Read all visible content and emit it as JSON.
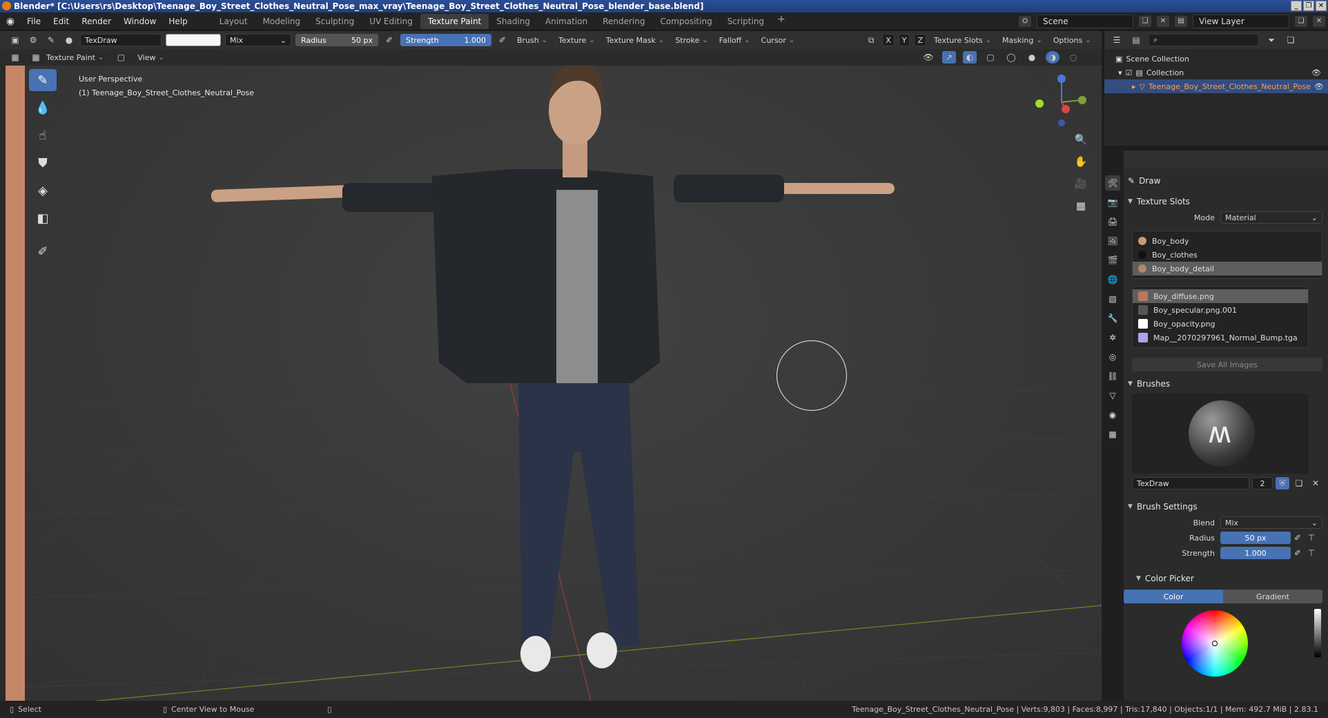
{
  "window": {
    "title": "Blender* [C:\\Users\\rs\\Desktop\\Teenage_Boy_Street_Clothes_Neutral_Pose_max_vray\\Teenage_Boy_Street_Clothes_Neutral_Pose_blender_base.blend]"
  },
  "menu": {
    "items": [
      "File",
      "Edit",
      "Render",
      "Window",
      "Help"
    ],
    "workspaces": [
      "Layout",
      "Modeling",
      "Sculpting",
      "UV Editing",
      "Texture Paint",
      "Shading",
      "Animation",
      "Rendering",
      "Compositing",
      "Scripting"
    ],
    "active_workspace": "Texture Paint",
    "scene": "Scene",
    "view_layer": "View Layer"
  },
  "tool_header": {
    "brush_name": "TexDraw",
    "blend": "Mix",
    "radius_label": "Radius",
    "radius_value": "50 px",
    "strength_label": "Strength",
    "strength_value": "1.000",
    "dropdowns": [
      "Brush",
      "Texture",
      "Texture Mask",
      "Stroke",
      "Falloff",
      "Cursor"
    ],
    "axes": [
      "X",
      "Y",
      "Z"
    ],
    "right_dropdowns": [
      "Texture Slots",
      "Masking",
      "Options"
    ]
  },
  "mode_header": {
    "mode": "Texture Paint",
    "view": "View"
  },
  "viewport": {
    "perspective": "User Perspective",
    "object_label": "(1) Teenage_Boy_Street_Clothes_Neutral_Pose"
  },
  "outliner": {
    "scene_collection": "Scene Collection",
    "collection": "Collection",
    "object": "Teenage_Boy_Street_Clothes_Neutral_Pose"
  },
  "properties": {
    "tool_name": "Draw",
    "texture_slots": {
      "title": "Texture Slots",
      "mode_label": "Mode",
      "mode_value": "Material",
      "materials": [
        "Boy_body",
        "Boy_clothes",
        "Boy_body_detail"
      ],
      "selected_material": "Boy_body_detail",
      "images": [
        "Boy_diffuse.png",
        "Boy_specular.png.001",
        "Boy_opacity.png",
        "Map__2070297961_Normal_Bump.tga"
      ],
      "selected_image": "Boy_diffuse.png",
      "save_all": "Save All Images"
    },
    "brushes": {
      "title": "Brushes",
      "brush_name": "TexDraw",
      "users": "2"
    },
    "brush_settings": {
      "title": "Brush Settings",
      "blend_label": "Blend",
      "blend_value": "Mix",
      "radius_label": "Radius",
      "radius_value": "50 px",
      "strength_label": "Strength",
      "strength_value": "1.000"
    },
    "color_picker": {
      "title": "Color Picker",
      "tab_color": "Color",
      "tab_gradient": "Gradient"
    }
  },
  "statusbar": {
    "select": "Select",
    "center_view": "Center View to Mouse",
    "info": "Teenage_Boy_Street_Clothes_Neutral_Pose | Verts:9,803 | Faces:8,997 | Tris:17,840 | Objects:1/1 | Mem: 492.7 MiB | 2.83.1"
  },
  "colors": {
    "accent": "#4772b3",
    "selection": "#334d80",
    "object_orange": "#f2a05a"
  }
}
